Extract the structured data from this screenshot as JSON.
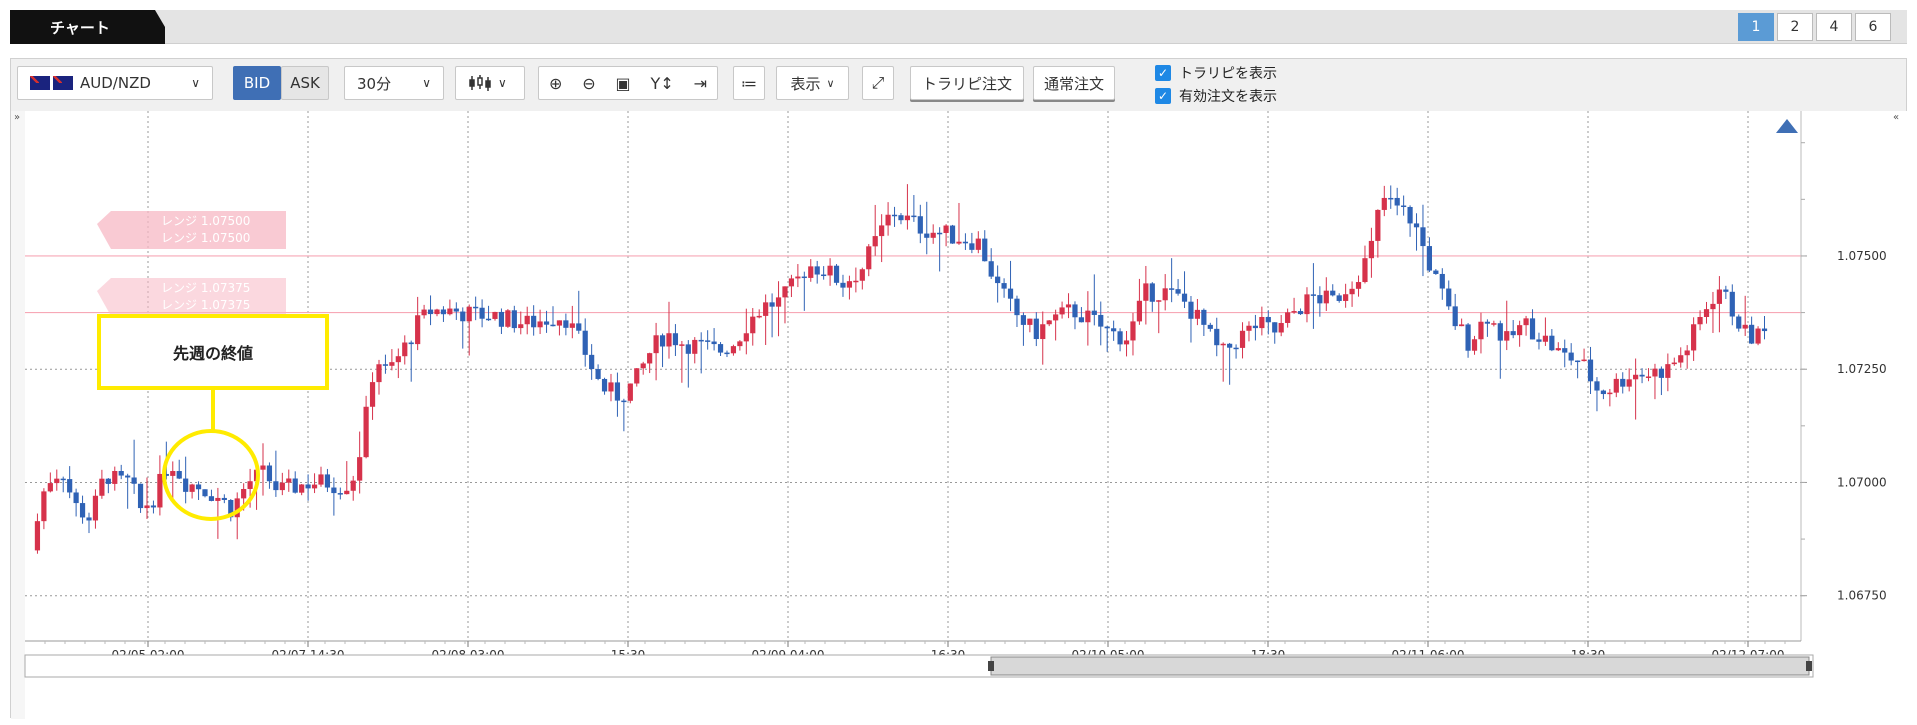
{
  "tabbar": {
    "active_tab": "チャート",
    "layouts": [
      "1",
      "2",
      "4",
      "6"
    ],
    "active_layout": "1"
  },
  "toolbar": {
    "pair": "AUD/NZD",
    "bid_label": "BID",
    "ask_label": "ASK",
    "interval": "30分",
    "display_label": "表示",
    "trap_order_label": "トラリピ注文",
    "normal_order_label": "通常注文",
    "show_trap_label": "トラリピを表示",
    "show_orders_label": "有効注文を表示"
  },
  "chart": {
    "price_labels": [
      "1.07500",
      "1.07250",
      "1.07000",
      "1.06750"
    ],
    "time_labels": [
      "02/05 02:00",
      "02/07 14:30",
      "02/08 03:00",
      "15:30",
      "02/09 04:00",
      "16:30",
      "02/10 05:00",
      "17:30",
      "02/11 06:00",
      "18:30",
      "02/12 07:00"
    ],
    "range_labels": [
      "レンジ 1.07500",
      "レンジ 1.07500",
      "レンジ 1.07375",
      "レンジ 1.07375"
    ],
    "annotation": "先週の終値",
    "colors": {
      "up": "#d6324b",
      "down": "#2f62b5",
      "range_line": "#f7a8b6"
    }
  },
  "chart_data": {
    "type": "candlestick",
    "pair": "AUD/NZD",
    "ylim": [
      1.0665,
      1.0782
    ],
    "range_lines": [
      1.075,
      1.07375
    ],
    "close_points": [
      [
        0,
        1.0685
      ],
      [
        12,
        1.07
      ],
      [
        25,
        1.0703
      ],
      [
        35,
        1.0695
      ],
      [
        48,
        1.0692
      ],
      [
        60,
        1.0702
      ],
      [
        70,
        1.07
      ],
      [
        80,
        1.07
      ],
      [
        88,
        1.0694
      ],
      [
        100,
        1.0697
      ],
      [
        112,
        1.0705
      ],
      [
        125,
        1.07
      ],
      [
        137,
        1.0699
      ],
      [
        150,
        1.0697
      ],
      [
        162,
        1.0694
      ],
      [
        175,
        1.07
      ],
      [
        188,
        1.0702
      ],
      [
        200,
        1.0698
      ],
      [
        212,
        1.0699
      ],
      [
        225,
        1.07
      ],
      [
        240,
        1.07
      ],
      [
        252,
        1.0699
      ],
      [
        262,
        1.0702
      ],
      [
        270,
        1.0714
      ],
      [
        278,
        1.0728
      ],
      [
        287,
        1.0724
      ],
      [
        300,
        1.0729
      ],
      [
        312,
        1.0735
      ],
      [
        323,
        1.0738
      ],
      [
        340,
        1.0738
      ],
      [
        355,
        1.0737
      ],
      [
        370,
        1.0737
      ],
      [
        385,
        1.0736
      ],
      [
        400,
        1.0735
      ],
      [
        415,
        1.0736
      ],
      [
        430,
        1.0737
      ],
      [
        445,
        1.073
      ],
      [
        460,
        1.0721
      ],
      [
        475,
        1.0719
      ],
      [
        487,
        1.0722
      ],
      [
        500,
        1.0729
      ],
      [
        512,
        1.0733
      ],
      [
        525,
        1.0731
      ],
      [
        540,
        1.073
      ],
      [
        555,
        1.0729
      ],
      [
        568,
        1.0731
      ],
      [
        580,
        1.0736
      ],
      [
        592,
        1.0739
      ],
      [
        605,
        1.074
      ],
      [
        617,
        1.0744
      ],
      [
        627,
        1.0748
      ],
      [
        640,
        1.0747
      ],
      [
        655,
        1.0744
      ],
      [
        670,
        1.0747
      ],
      [
        683,
        1.0754
      ],
      [
        695,
        1.076
      ],
      [
        707,
        1.0758
      ],
      [
        720,
        1.0756
      ],
      [
        735,
        1.0755
      ],
      [
        750,
        1.0754
      ],
      [
        765,
        1.0753
      ],
      [
        780,
        1.0743
      ],
      [
        795,
        1.0737
      ],
      [
        810,
        1.0733
      ],
      [
        825,
        1.0736
      ],
      [
        840,
        1.0738
      ],
      [
        855,
        1.0736
      ],
      [
        870,
        1.0733
      ],
      [
        885,
        1.0732
      ],
      [
        900,
        1.0742
      ],
      [
        915,
        1.0742
      ],
      [
        930,
        1.074
      ],
      [
        945,
        1.0735
      ],
      [
        960,
        1.0728
      ],
      [
        975,
        1.0732
      ],
      [
        990,
        1.0735
      ],
      [
        1005,
        1.0733
      ],
      [
        1020,
        1.0738
      ],
      [
        1035,
        1.0741
      ],
      [
        1050,
        1.074
      ],
      [
        1065,
        1.0744
      ],
      [
        1080,
        1.075
      ],
      [
        1090,
        1.0763
      ],
      [
        1100,
        1.0761
      ],
      [
        1115,
        1.0758
      ],
      [
        1130,
        1.0747
      ],
      [
        1145,
        1.0737
      ],
      [
        1160,
        1.0731
      ],
      [
        1175,
        1.0737
      ],
      [
        1190,
        1.0731
      ],
      [
        1205,
        1.0735
      ],
      [
        1220,
        1.0732
      ],
      [
        1235,
        1.0728
      ],
      [
        1250,
        1.0727
      ],
      [
        1265,
        1.072
      ],
      [
        1275,
        1.0721
      ],
      [
        1290,
        1.0724
      ],
      [
        1305,
        1.0724
      ],
      [
        1320,
        1.0725
      ],
      [
        1335,
        1.0729
      ],
      [
        1350,
        1.0738
      ],
      [
        1362,
        1.0743
      ],
      [
        1375,
        1.0737
      ],
      [
        1385,
        1.0732
      ],
      [
        1400,
        1.0733
      ]
    ]
  }
}
